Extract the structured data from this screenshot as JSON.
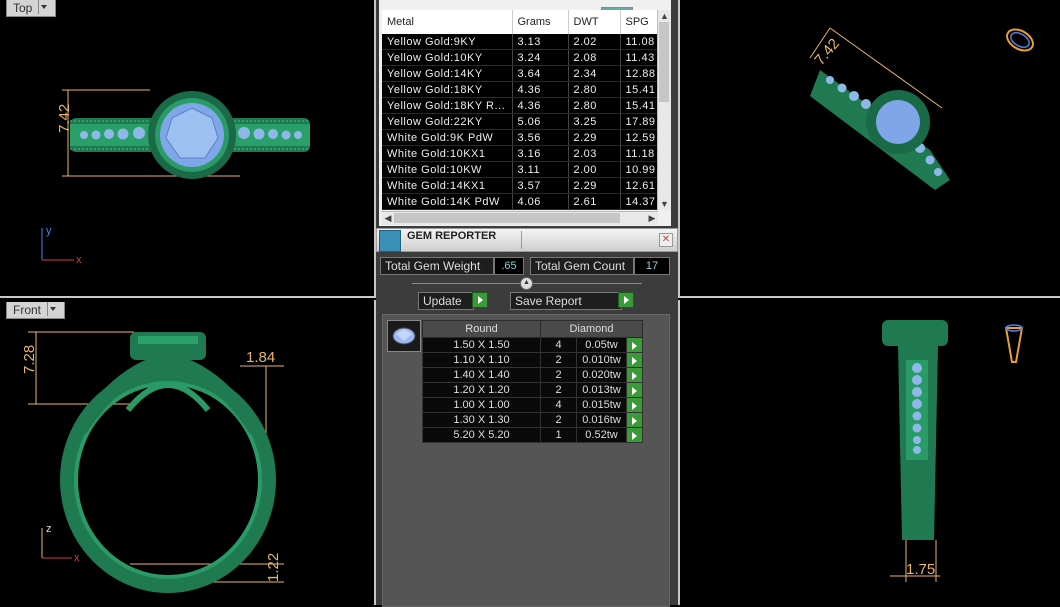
{
  "viewports": {
    "top": {
      "label": "Top",
      "dim": "7.42",
      "axis_v": "y",
      "axis_h": "x"
    },
    "front": {
      "label": "Front",
      "dim_left": "7.28",
      "dim_right": "1.84",
      "dim_bottom": "1.22",
      "axis_v": "z",
      "axis_h": "x"
    },
    "iso": {
      "dim": "7.42"
    },
    "side": {
      "dim": "1.75"
    }
  },
  "metal_table": {
    "headers": [
      "Metal",
      "Grams",
      "DWT",
      "SPG"
    ],
    "rows": [
      [
        "Yellow Gold:9KY",
        "3.13",
        "2.02",
        "11.08"
      ],
      [
        "Yellow Gold:10KY",
        "3.24",
        "2.08",
        "11.43"
      ],
      [
        "Yellow Gold:14KY",
        "3.64",
        "2.34",
        "12.88"
      ],
      [
        "Yellow Gold:18KY",
        "4.36",
        "2.80",
        "15.41"
      ],
      [
        "Yellow Gold:18KY R...",
        "4.36",
        "2.80",
        "15.41"
      ],
      [
        "Yellow Gold:22KY",
        "5.06",
        "3.25",
        "17.89"
      ],
      [
        "White Gold:9K PdW",
        "3.56",
        "2.29",
        "12.59"
      ],
      [
        "White Gold:10KX1",
        "3.16",
        "2.03",
        "11.18"
      ],
      [
        "White Gold:10KW",
        "3.11",
        "2.00",
        "10.99"
      ],
      [
        "White Gold:14KX1",
        "3.57",
        "2.29",
        "12.61"
      ],
      [
        "White Gold:14K PdW",
        "4.06",
        "2.61",
        "14.37"
      ]
    ]
  },
  "gem_reporter": {
    "title": "GEM REPORTER",
    "total_weight_label": "Total Gem Weight",
    "total_weight_value": ".65",
    "total_count_label": "Total Gem Count",
    "total_count_value": "17",
    "update_label": "Update",
    "save_label": "Save Report",
    "shape_header": "Round",
    "material_header": "Diamond",
    "rows": [
      [
        "1.50 X 1.50",
        "4",
        "0.05tw"
      ],
      [
        "1.10 X 1.10",
        "2",
        "0.010tw"
      ],
      [
        "1.40 X 1.40",
        "2",
        "0.020tw"
      ],
      [
        "1.20 X 1.20",
        "2",
        "0.013tw"
      ],
      [
        "1.00 X 1.00",
        "4",
        "0.015tw"
      ],
      [
        "1.30 X 1.30",
        "2",
        "0.016tw"
      ],
      [
        "5.20 X 5.20",
        "1",
        "0.52tw"
      ]
    ]
  },
  "colors": {
    "metal": "#1f8a5e",
    "gem": "#7fa6e8",
    "dimension": "#e8b56a",
    "axis_red": "#d04040",
    "axis_blue": "#5080e0"
  }
}
